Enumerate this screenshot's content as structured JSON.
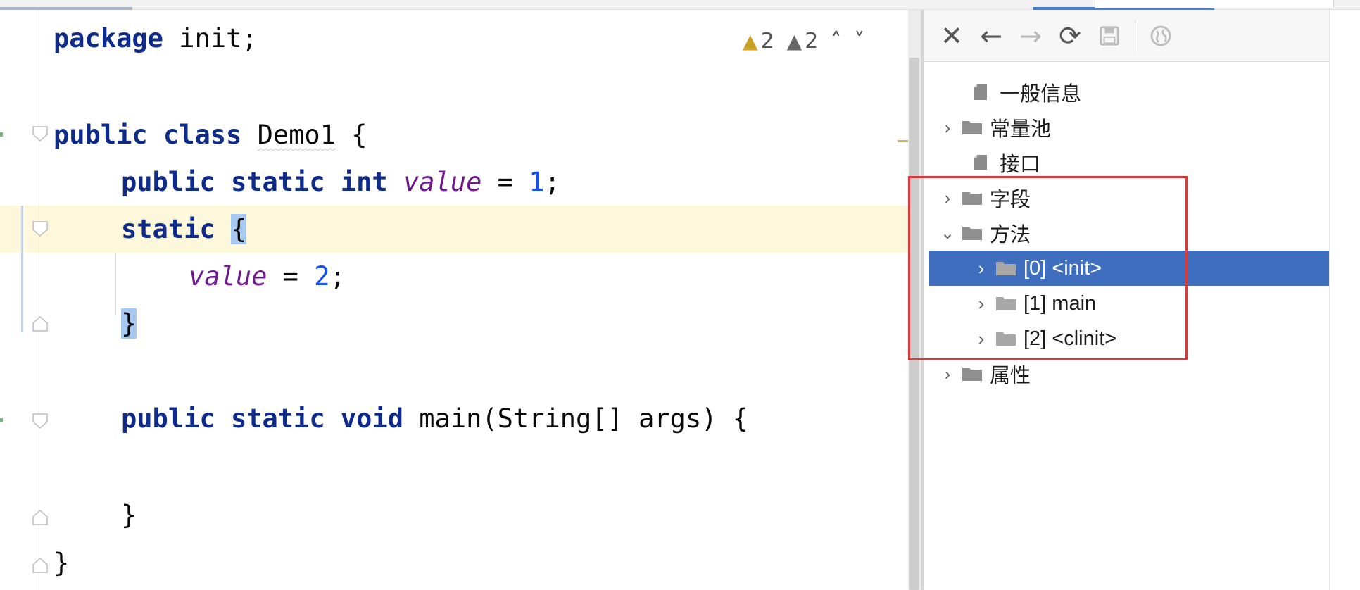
{
  "editor": {
    "code": {
      "package_kw": "package",
      "package_rest": " init;",
      "public": "public",
      "class": "class",
      "class_name": "Demo1",
      "open_brace": "{",
      "static": "static",
      "int": "int",
      "field": "value",
      "eq1": " = ",
      "one": "1",
      "semi": ";",
      "static_block_brace": "{",
      "eq2": " = ",
      "two": "2",
      "close_brace": "}",
      "void": "void",
      "main_sig": "main(String[] args) {",
      "end_brace": "}"
    },
    "inspections": {
      "warning_count": "2",
      "weak_warning_count": "2",
      "up": "˄",
      "down": "˅"
    }
  },
  "toolbar": {
    "close": "✕",
    "back": "←",
    "forward": "→",
    "refresh": "⟳",
    "save": "💾",
    "web": "🌐"
  },
  "tree": {
    "general_info": "一般信息",
    "constant_pool": "常量池",
    "interfaces": "接口",
    "fields": "字段",
    "methods": "方法",
    "method_init": "[0] <init>",
    "method_main": "[1] main",
    "method_clinit": "[2] <clinit>",
    "attributes": "属性",
    "expand": "›",
    "collapse": "⌄"
  },
  "colors": {
    "keyword": "#0e2a8a",
    "field": "#6f1a8a",
    "number": "#1750eb",
    "selection": "#3f6ebe",
    "annotation": "#d63a3a"
  }
}
